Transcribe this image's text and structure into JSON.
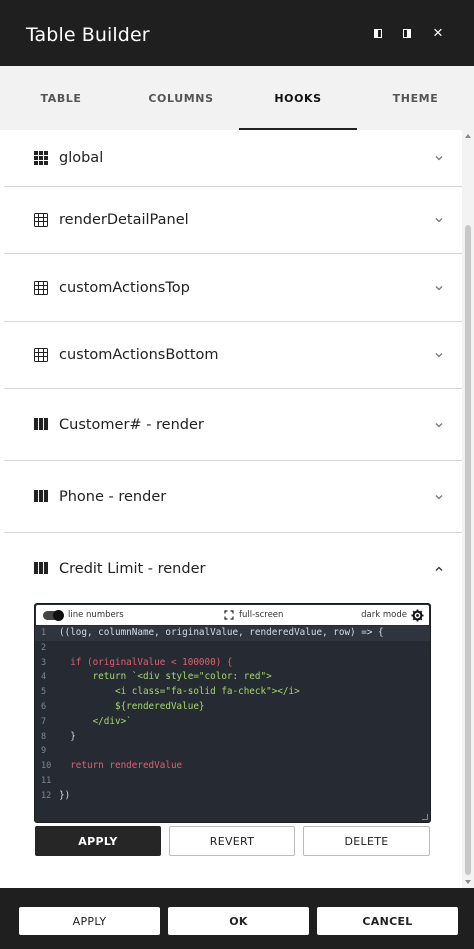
{
  "window": {
    "title": "Table Builder",
    "controls": [
      "dock-left-icon",
      "dock-right-icon",
      "close-icon"
    ],
    "close_glyph": "×"
  },
  "tabs": [
    {
      "label": "TABLE",
      "active": false
    },
    {
      "label": "COLUMNS",
      "active": false
    },
    {
      "label": "HOOKS",
      "active": true
    },
    {
      "label": "THEME",
      "active": false
    }
  ],
  "hooks": [
    {
      "label": "global",
      "icon": "grid-icon",
      "expanded": false
    },
    {
      "label": "renderDetailPanel",
      "icon": "table-icon",
      "expanded": false
    },
    {
      "label": "customActionsTop",
      "icon": "table-icon",
      "expanded": false
    },
    {
      "label": "customActionsBottom",
      "icon": "table-icon",
      "expanded": false
    },
    {
      "label": "Customer# - render",
      "icon": "columns-icon",
      "expanded": false
    },
    {
      "label": "Phone - render",
      "icon": "columns-icon",
      "expanded": false
    },
    {
      "label": "Credit Limit - render",
      "icon": "columns-icon",
      "expanded": true
    }
  ],
  "editor": {
    "line_numbers_label": "line numbers",
    "line_numbers_on": true,
    "fullscreen_label": "full-screen",
    "dark_mode_label": "dark mode",
    "lines": [
      {
        "n": "1",
        "text": "((log, columnName, originalValue, renderedValue, row) => {"
      },
      {
        "n": "2",
        "text": ""
      },
      {
        "n": "3",
        "text": "  if (originalValue < 100000) {"
      },
      {
        "n": "4",
        "text": "      return `<div style=\"color: red\">"
      },
      {
        "n": "5",
        "text": "          <i class=\"fa-solid fa-check\"></i>"
      },
      {
        "n": "6",
        "text": "          ${renderedValue}"
      },
      {
        "n": "7",
        "text": "      </div>`"
      },
      {
        "n": "8",
        "text": "  }"
      },
      {
        "n": "9",
        "text": ""
      },
      {
        "n": "10",
        "text": "  return renderedValue"
      },
      {
        "n": "11",
        "text": ""
      },
      {
        "n": "12",
        "text": "})"
      }
    ]
  },
  "hook_actions": {
    "apply": "APPLY",
    "revert": "REVERT",
    "delete": "DELETE"
  },
  "footer": {
    "apply": "APPLY",
    "ok": "OK",
    "cancel": "CANCEL"
  },
  "colors": {
    "header_bg": "#1f1f1f",
    "editor_bg": "#262b33",
    "keyword": "#e0606e",
    "string": "#a5d86b",
    "number": "#e5c07b"
  }
}
